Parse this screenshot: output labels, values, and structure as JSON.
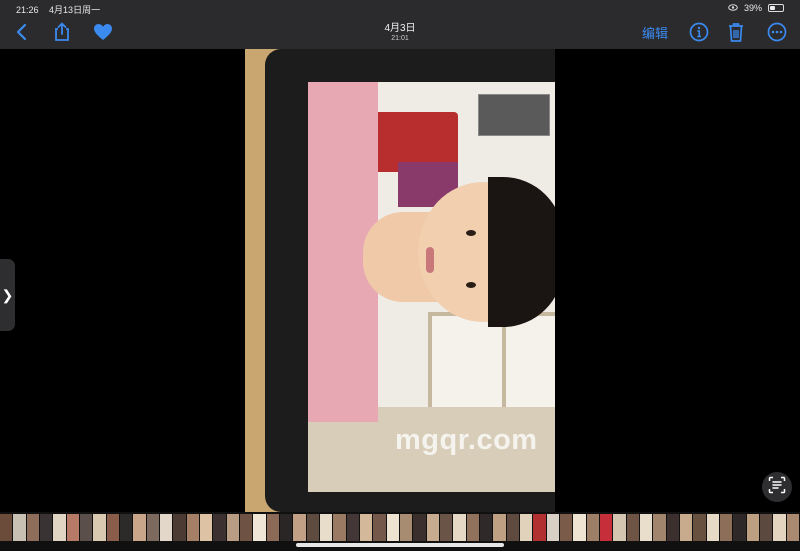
{
  "status_bar": {
    "time": "21:26",
    "date": "4月13日周一",
    "battery": "39%",
    "battery_level": 0.39
  },
  "toolbar": {
    "title": "4月3日",
    "subtitle": "21:01",
    "edit_label": "编辑",
    "accent_color": "#3a8af0",
    "icons": [
      "chevron-left-icon",
      "share-icon",
      "heart-icon",
      "info-icon",
      "trash-icon",
      "more-icon"
    ]
  },
  "viewer": {
    "watermark": "mgqr.com",
    "sidebar_toggle_glyph": "❯"
  },
  "filmstrip": {
    "thumbnail_colors": [
      "#6b4b3a",
      "#c8c0b2",
      "#8e6d5a",
      "#3a3333",
      "#e0d5c2",
      "#b77a66",
      "#5a4f4a",
      "#d8c9b0",
      "#8a5c4a",
      "#2d2a2a",
      "#c9a68a",
      "#7d6a5e",
      "#e3d7c9",
      "#4b3b33",
      "#a68066",
      "#ddc3a3",
      "#3d3030",
      "#b89d84",
      "#6e5244",
      "#f0e6d8",
      "#8b6b57",
      "#2b2626",
      "#c1a085",
      "#5d4b40",
      "#e8dccb",
      "#9b7a63",
      "#433636",
      "#d3b899",
      "#74594a",
      "#eee2d0",
      "#a88c72",
      "#3a2f2c",
      "#c7ab8e",
      "#6a5347",
      "#e5d8c5",
      "#8f715c",
      "#2f2929",
      "#bfa083",
      "#5e4a3f",
      "#e1d2bc",
      "#b23030",
      "#d8d0c4",
      "#7a5b49",
      "#efe3d1",
      "#9d7e66",
      "#c62e3a",
      "#d4c5b0",
      "#6d5445",
      "#e9ddcb",
      "#a1856d",
      "#3b302d",
      "#c8aa8c",
      "#68513f",
      "#e6d9c6",
      "#8c6e59",
      "#2e2828",
      "#bd9f82",
      "#5b483e",
      "#e2d4bf",
      "#a9896f"
    ]
  }
}
